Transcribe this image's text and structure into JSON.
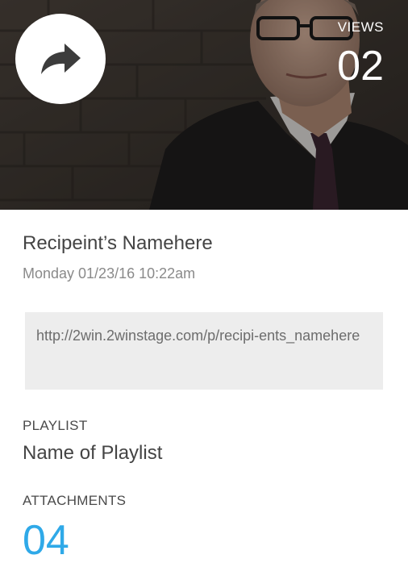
{
  "header": {
    "share_icon": "share-arrow-icon",
    "views_label": "VIEWS",
    "views_count": "02"
  },
  "recipient": {
    "name": "Recipeint’s Namehere",
    "sent_date": "Monday 01/23/16 10:22am",
    "link": "http://2win.2winstage.com/p/recipi-ents_namehere"
  },
  "playlist": {
    "label": "PLAYLIST",
    "name": "Name of Playlist"
  },
  "attachments": {
    "label": "ATTACHMENTS",
    "count": "04"
  },
  "colors": {
    "accent": "#2fa9e8",
    "link_box_bg": "#ededed"
  }
}
